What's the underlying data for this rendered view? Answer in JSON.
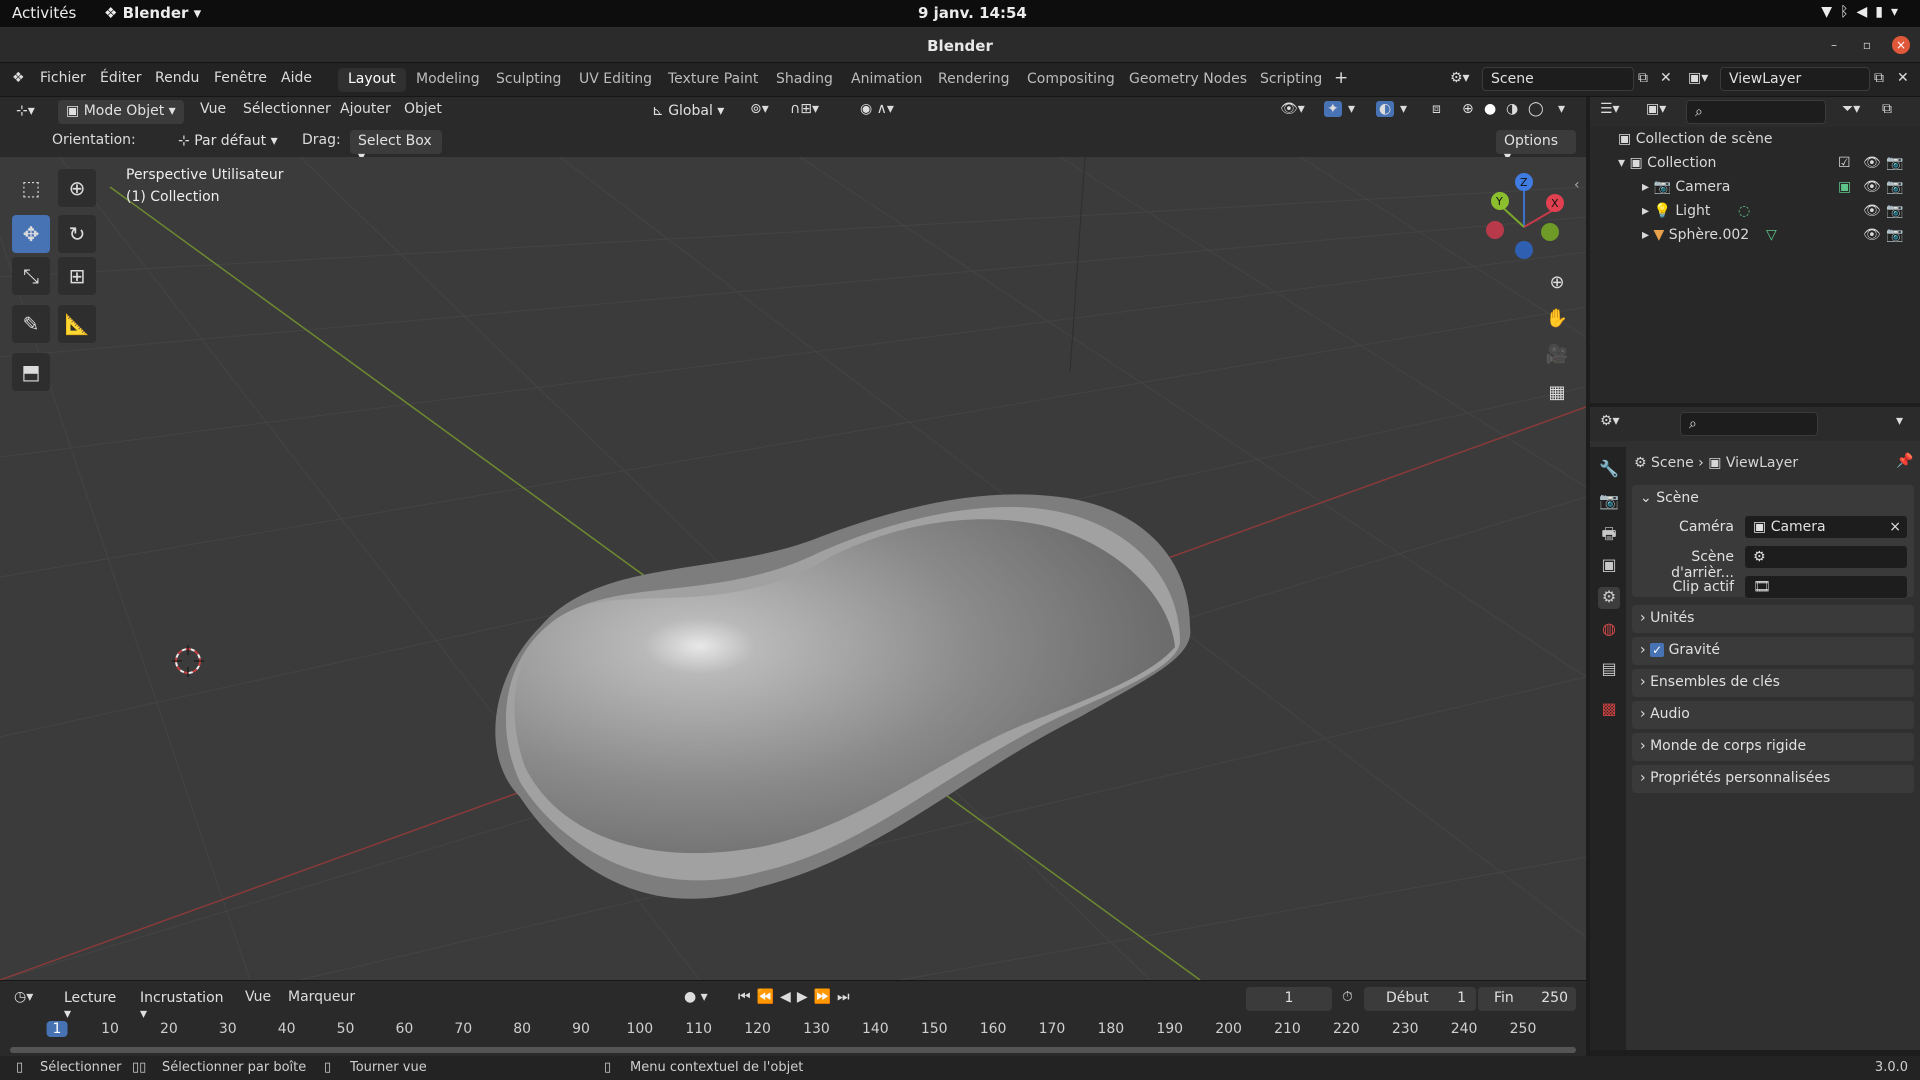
{
  "system": {
    "activities": "Activités",
    "app_menu": "Blender",
    "clock": "9 janv.  14:54"
  },
  "window": {
    "title": "Blender"
  },
  "menubar": {
    "items": [
      "Fichier",
      "Éditer",
      "Rendu",
      "Fenêtre",
      "Aide"
    ],
    "workspaces": [
      "Layout",
      "Modeling",
      "Sculpting",
      "UV Editing",
      "Texture Paint",
      "Shading",
      "Animation",
      "Rendering",
      "Compositing",
      "Geometry Nodes",
      "Scripting"
    ],
    "active_workspace": "Layout",
    "scene_value": "Scene",
    "viewlayer_value": "ViewLayer"
  },
  "viewport_header": {
    "mode": "Mode Objet",
    "menus": [
      "Vue",
      "Sélectionner",
      "Ajouter",
      "Objet"
    ],
    "transform": "Global"
  },
  "viewport_options": {
    "orientation_label": "Orientation:",
    "orientation_value": "Par défaut",
    "drag_label": "Drag:",
    "drag_value": "Select Box",
    "options": "Options"
  },
  "viewport": {
    "view_name": "Perspective Utilisateur",
    "collection_name": "(1) Collection",
    "gizmo_x": "X",
    "gizmo_y": "Y",
    "gizmo_z": "Z",
    "colors": {
      "x_axis": "#c8394b",
      "y_axis": "#7aaa28",
      "z_axis": "#2f6fd0"
    }
  },
  "outliner": {
    "root": "Collection de scène",
    "collection": "Collection",
    "objects": [
      "Camera",
      "Light",
      "Sphère.002"
    ]
  },
  "properties": {
    "breadcrumb_scene": "Scene",
    "breadcrumb_layer": "ViewLayer",
    "section": "Scène",
    "camera_label": "Caméra",
    "camera_value": "Camera",
    "background_label": "Scène d'arrièr...",
    "clip_label": "Clip actif",
    "panels": [
      "Unités",
      "Gravité",
      "Ensembles de clés",
      "Audio",
      "Monde de corps rigide",
      "Propriétés personnalisées"
    ]
  },
  "timeline": {
    "menus": [
      "Lecture",
      "Incrustation",
      "Vue",
      "Marqueur"
    ],
    "current_frame": "1",
    "start_label": "Début",
    "start_value": "1",
    "end_label": "Fin",
    "end_value": "250",
    "ruler": [
      "1",
      "10",
      "20",
      "30",
      "40",
      "50",
      "60",
      "70",
      "80",
      "90",
      "100",
      "110",
      "120",
      "130",
      "140",
      "150",
      "160",
      "170",
      "180",
      "190",
      "200",
      "210",
      "220",
      "230",
      "240",
      "250"
    ]
  },
  "statusbar": {
    "select": "Sélectionner",
    "box_select": "Sélectionner par boîte",
    "rotate": "Tourner vue",
    "context": "Menu contextuel de l'objet",
    "version": "3.0.0"
  }
}
